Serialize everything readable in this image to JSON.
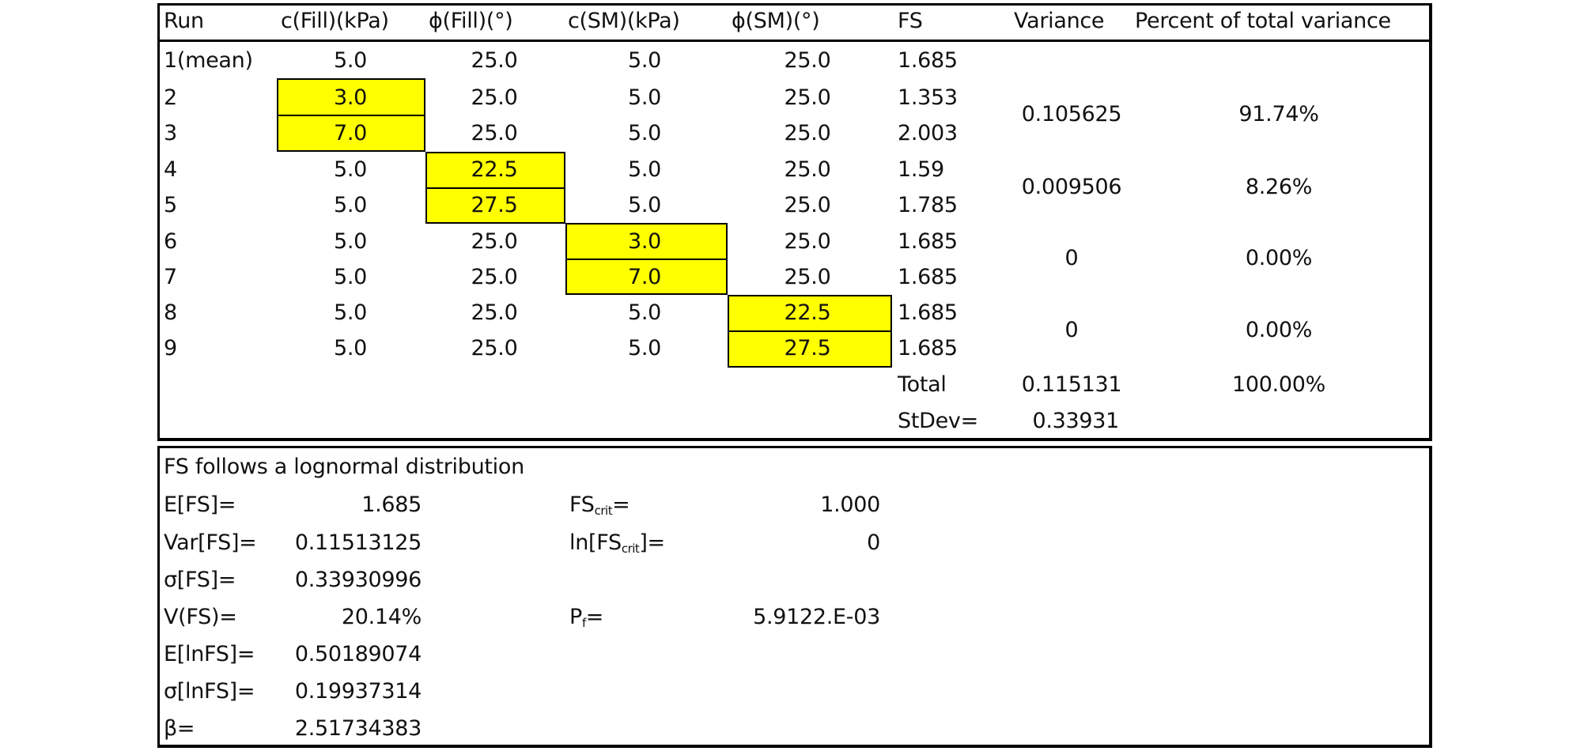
{
  "table": {
    "headers": [
      "Run",
      "c(Fill)(kPa)",
      "ϕ(Fill)(°)",
      "c(SM)(kPa)",
      "ϕ(SM)(°)",
      "FS",
      "Variance",
      "Percent of total variance"
    ],
    "rows": [
      {
        "run": "1(mean)",
        "c_fill": "5.0",
        "phi_fill": "25.0",
        "c_sm": "5.0",
        "phi_sm": "25.0",
        "fs": "1.685"
      },
      {
        "run": "2",
        "c_fill": "3.0",
        "phi_fill": "25.0",
        "c_sm": "5.0",
        "phi_sm": "25.0",
        "fs": "1.353"
      },
      {
        "run": "3",
        "c_fill": "7.0",
        "phi_fill": "25.0",
        "c_sm": "5.0",
        "phi_sm": "25.0",
        "fs": "2.003"
      },
      {
        "run": "4",
        "c_fill": "5.0",
        "phi_fill": "22.5",
        "c_sm": "5.0",
        "phi_sm": "25.0",
        "fs": "1.59"
      },
      {
        "run": "5",
        "c_fill": "5.0",
        "phi_fill": "27.5",
        "c_sm": "5.0",
        "phi_sm": "25.0",
        "fs": "1.785"
      },
      {
        "run": "6",
        "c_fill": "5.0",
        "phi_fill": "25.0",
        "c_sm": "3.0",
        "phi_sm": "25.0",
        "fs": "1.685"
      },
      {
        "run": "7",
        "c_fill": "5.0",
        "phi_fill": "25.0",
        "c_sm": "7.0",
        "phi_sm": "25.0",
        "fs": "1.685"
      },
      {
        "run": "8",
        "c_fill": "5.0",
        "phi_fill": "25.0",
        "c_sm": "5.0",
        "phi_sm": "22.5",
        "fs": "1.685"
      },
      {
        "run": "9",
        "c_fill": "5.0",
        "phi_fill": "25.0",
        "c_sm": "5.0",
        "phi_sm": "27.5",
        "fs": "1.685"
      }
    ],
    "groups": [
      {
        "variance": "0.105625",
        "percent": "91.74%"
      },
      {
        "variance": "0.009506",
        "percent": "8.26%"
      },
      {
        "variance": "0",
        "percent": "0.00%"
      },
      {
        "variance": "0",
        "percent": "0.00%"
      }
    ],
    "total_label": "Total",
    "total_variance": "0.115131",
    "total_percent": "100.00%",
    "stdev_label": "StDev=",
    "stdev_value": "0.33931",
    "highlight_color": "#ffff00"
  },
  "summary": {
    "title": "FS  follows a lognormal distribution",
    "e_fs_label": "E[FS]=",
    "e_fs_value": "1.685",
    "var_fs_label": "Var[FS]=",
    "var_fs_value": "0.11513125",
    "sigma_fs_label": "σ[FS]=",
    "sigma_fs_value": "0.33930996",
    "v_fs_label": "V(FS)=",
    "v_fs_value": "20.14%",
    "e_lnfs_label": "E[lnFS]=",
    "e_lnfs_value": "0.50189074",
    "sigma_lnfs_label": "σ[lnFS]=",
    "sigma_lnfs_value": "0.19937314",
    "beta_label": "β=",
    "beta_value": "2.51734383",
    "fs_crit_label": "FS",
    "fs_crit_sub": "crit",
    "fs_crit_eq": "=",
    "fs_crit_value": "1.000",
    "ln_fs_crit_label_pre": "ln[FS",
    "ln_fs_crit_sub": "crit",
    "ln_fs_crit_label_post": "]=",
    "ln_fs_crit_value": "0",
    "pf_label": "P",
    "pf_sub": "f",
    "pf_eq": "=",
    "pf_value": "5.9122.E-03"
  }
}
